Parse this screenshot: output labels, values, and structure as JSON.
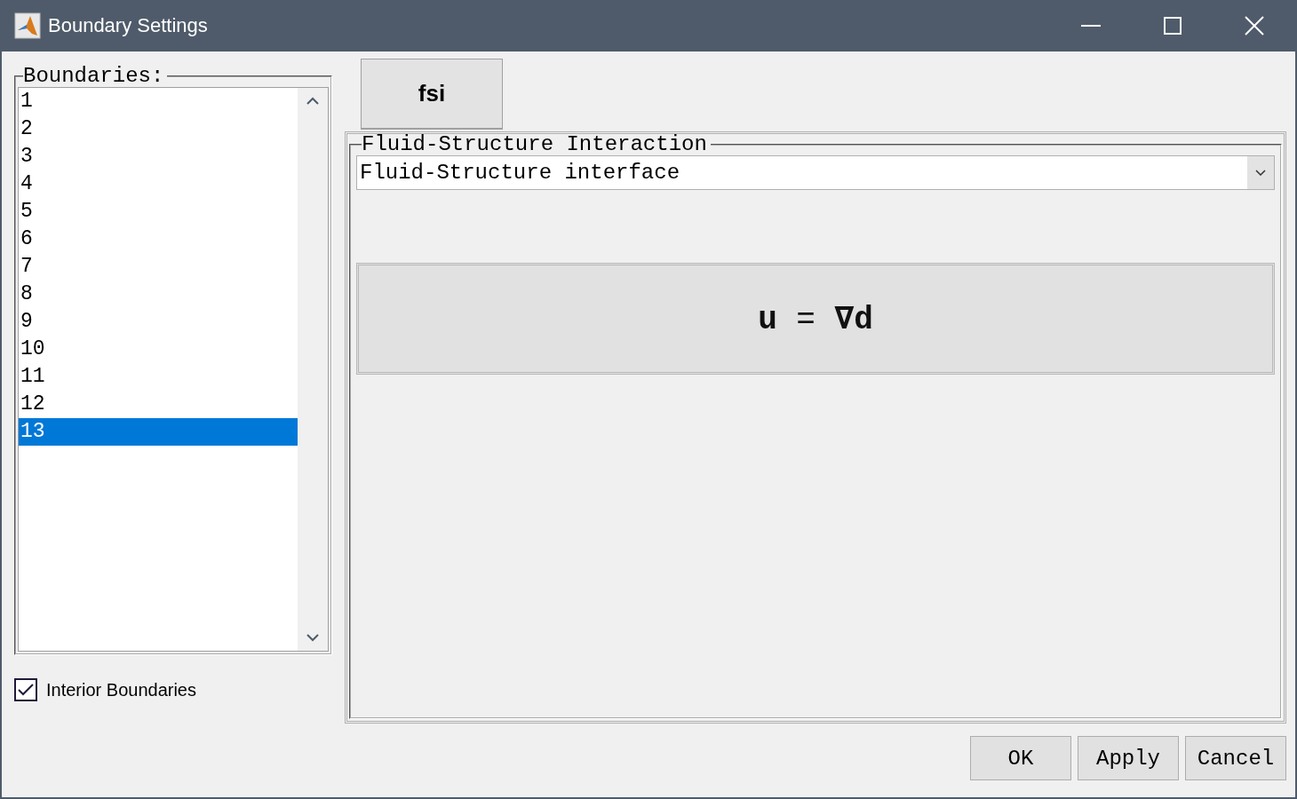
{
  "window": {
    "title": "Boundary Settings"
  },
  "boundaries": {
    "label": "Boundaries:",
    "items": [
      {
        "label": "1",
        "selected": false
      },
      {
        "label": "2",
        "selected": false
      },
      {
        "label": "3",
        "selected": false
      },
      {
        "label": "4",
        "selected": false
      },
      {
        "label": "5",
        "selected": false
      },
      {
        "label": "6",
        "selected": false
      },
      {
        "label": "7",
        "selected": false
      },
      {
        "label": "8",
        "selected": false
      },
      {
        "label": "9",
        "selected": false
      },
      {
        "label": "10",
        "selected": false
      },
      {
        "label": "11",
        "selected": false
      },
      {
        "label": "12",
        "selected": false
      },
      {
        "label": "13",
        "selected": true
      }
    ]
  },
  "interior_boundaries": {
    "label": "Interior Boundaries",
    "checked": true
  },
  "tabs": [
    {
      "label": "fsi",
      "selected": true
    }
  ],
  "group": {
    "title": "Fluid-Structure Interaction",
    "dropdown": {
      "value": "Fluid-Structure interface"
    },
    "equation": "**u** = **∇d**"
  },
  "buttons": [
    {
      "label": "OK"
    },
    {
      "label": "Apply"
    },
    {
      "label": "Cancel"
    }
  ]
}
